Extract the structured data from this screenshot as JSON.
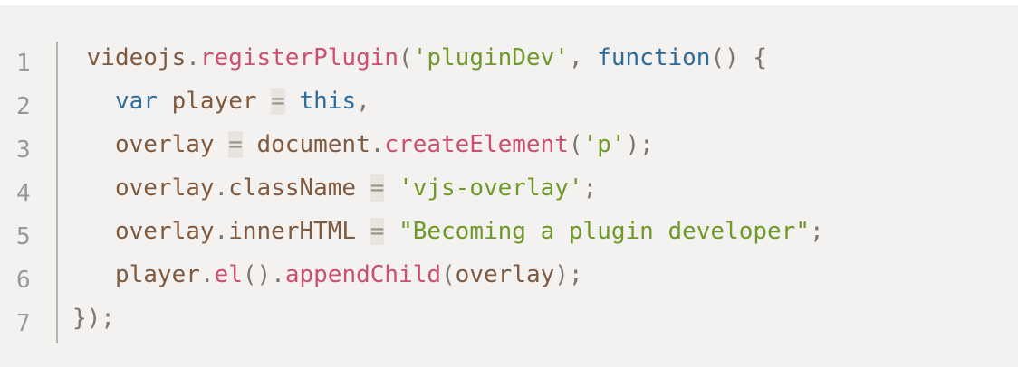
{
  "code": {
    "line_numbers": [
      "1",
      "2",
      "3",
      "4",
      "5",
      "6",
      "7"
    ],
    "lines": [
      [
        {
          "t": " videojs",
          "c": ""
        },
        {
          "t": ".",
          "c": "pun"
        },
        {
          "t": "registerPlugin",
          "c": "fn"
        },
        {
          "t": "(",
          "c": "pun"
        },
        {
          "t": "'pluginDev'",
          "c": "str"
        },
        {
          "t": ", ",
          "c": "pun"
        },
        {
          "t": "function",
          "c": "kw"
        },
        {
          "t": "() {",
          "c": "pun"
        }
      ],
      [
        {
          "t": "   ",
          "c": ""
        },
        {
          "t": "var",
          "c": "kw"
        },
        {
          "t": " player ",
          "c": ""
        },
        {
          "t": "=",
          "c": "op"
        },
        {
          "t": " ",
          "c": ""
        },
        {
          "t": "this",
          "c": "kw"
        },
        {
          "t": ",",
          "c": "pun"
        }
      ],
      [
        {
          "t": "   overlay ",
          "c": ""
        },
        {
          "t": "=",
          "c": "op"
        },
        {
          "t": " document",
          "c": ""
        },
        {
          "t": ".",
          "c": "pun"
        },
        {
          "t": "createElement",
          "c": "fn"
        },
        {
          "t": "(",
          "c": "pun"
        },
        {
          "t": "'p'",
          "c": "str"
        },
        {
          "t": ");",
          "c": "pun"
        }
      ],
      [
        {
          "t": "   overlay",
          "c": ""
        },
        {
          "t": ".",
          "c": "pun"
        },
        {
          "t": "className ",
          "c": ""
        },
        {
          "t": "=",
          "c": "op"
        },
        {
          "t": " ",
          "c": ""
        },
        {
          "t": "'vjs-overlay'",
          "c": "str"
        },
        {
          "t": ";",
          "c": "pun"
        }
      ],
      [
        {
          "t": "   overlay",
          "c": ""
        },
        {
          "t": ".",
          "c": "pun"
        },
        {
          "t": "innerHTML ",
          "c": ""
        },
        {
          "t": "=",
          "c": "op"
        },
        {
          "t": " ",
          "c": ""
        },
        {
          "t": "\"Becoming a plugin developer\"",
          "c": "str"
        },
        {
          "t": ";",
          "c": "pun"
        }
      ],
      [
        {
          "t": "   player",
          "c": ""
        },
        {
          "t": ".",
          "c": "pun"
        },
        {
          "t": "el",
          "c": "fn"
        },
        {
          "t": "().",
          "c": "pun"
        },
        {
          "t": "appendChild",
          "c": "fn"
        },
        {
          "t": "(",
          "c": "pun"
        },
        {
          "t": "overlay",
          "c": ""
        },
        {
          "t": ");",
          "c": "pun"
        }
      ],
      [
        {
          "t": "});",
          "c": "pun"
        }
      ]
    ]
  }
}
